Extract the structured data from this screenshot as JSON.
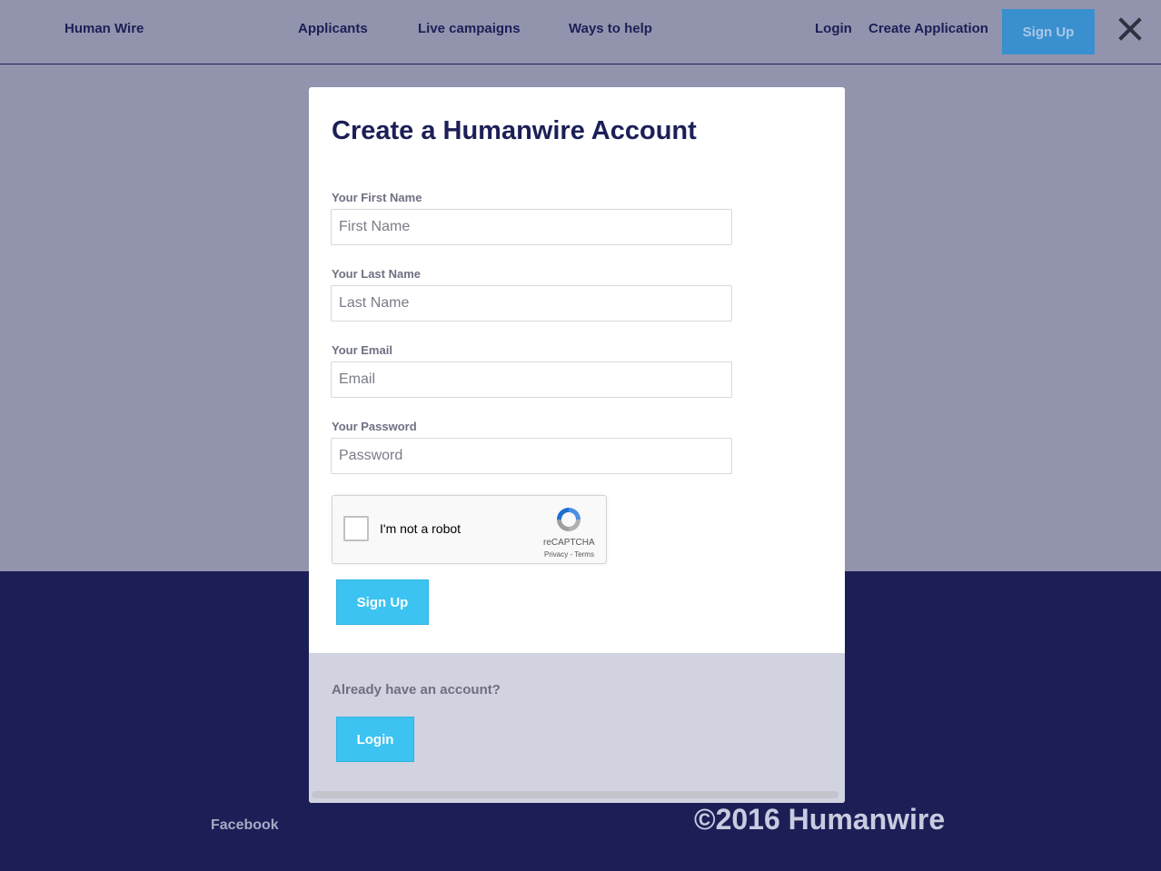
{
  "nav": {
    "brand": "Human Wire",
    "links": [
      "Applicants",
      "Live campaigns",
      "Ways to help"
    ],
    "login": "Login",
    "create_application": "Create Application",
    "signup": "Sign Up"
  },
  "modal": {
    "title": "Create a Humanwire Account",
    "fields": [
      {
        "label": "Your First Name",
        "placeholder": "First Name",
        "value": ""
      },
      {
        "label": "Your Last Name",
        "placeholder": "Last Name",
        "value": ""
      },
      {
        "label": "Your Email",
        "placeholder": "Email",
        "value": ""
      },
      {
        "label": "Your Password",
        "placeholder": "Password",
        "value": ""
      }
    ],
    "recaptcha": {
      "text": "I'm not a robot",
      "brand": "reCAPTCHA",
      "links": "Privacy - Terms"
    },
    "signup_button": "Sign Up",
    "already_text": "Already have an account?",
    "login_button": "Login"
  },
  "footer": {
    "facebook": "Facebook",
    "copyright": "©2016 Humanwire"
  },
  "colors": {
    "navy": "#1c1f56",
    "cyan": "#3cc3f1",
    "nav_signup": "#3a8fcf"
  }
}
